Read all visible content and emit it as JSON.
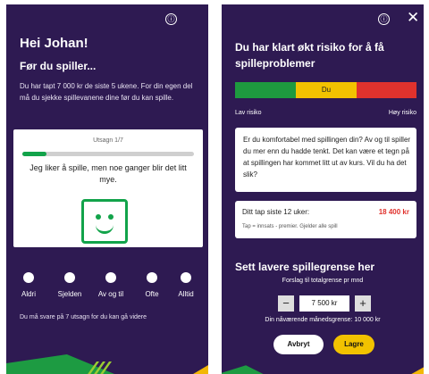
{
  "screen1": {
    "greeting": "Hei Johan!",
    "subheading": "Før du spiller...",
    "intro": "Du har tapt 7 000 kr de siste 5 ukene. For din egen del må du sjekke spillevanene dine før du kan spille.",
    "card": {
      "counter": "Utsagn 1/7",
      "progress": 0.14,
      "statement": "Jeg liker å spille, men noe ganger blir det litt mye."
    },
    "options": [
      "Aldri",
      "Sjelden",
      "Av og til",
      "Ofte",
      "Alltid"
    ],
    "footer": "Du må svare på 7 utsagn for du kan gå videre",
    "colors": {
      "background": "#2e1a52",
      "accent_green": "#12a34a",
      "accent_yellow": "#f2b705"
    }
  },
  "screen2": {
    "heading": "Du har klart økt risiko for å få spilleproblemer",
    "risk_marker": "Du",
    "risk_low": "Lav risiko",
    "risk_high": "Høy risiko",
    "risk_colors": [
      "#1e9a3f",
      "#f2c200",
      "#e0322d"
    ],
    "info_text": "Er du komfortabel med spillingen din? Av og til spiller du mer enn du hadde tenkt. Det kan være et tegn på at spillingen har kommet litt ut av kurs. Vil du ha det slik?",
    "loss_label": "Ditt tap siste 12 uker:",
    "loss_value": "18 400 kr",
    "loss_note": "Tap = innsats - premier. Gjelder alle spill",
    "limit_heading": "Sett lavere spillegrense her",
    "limit_subtext": "Forslag til totalgrense pr mnd",
    "minus": "−",
    "limit_value": "7 500 kr",
    "plus": "+",
    "current_limit": "Din nåværende månedsgrense: 10 000 kr",
    "cancel_label": "Avbryt",
    "save_label": "Lagre",
    "info_icon": "ⓘ",
    "close_icon": "✕"
  }
}
